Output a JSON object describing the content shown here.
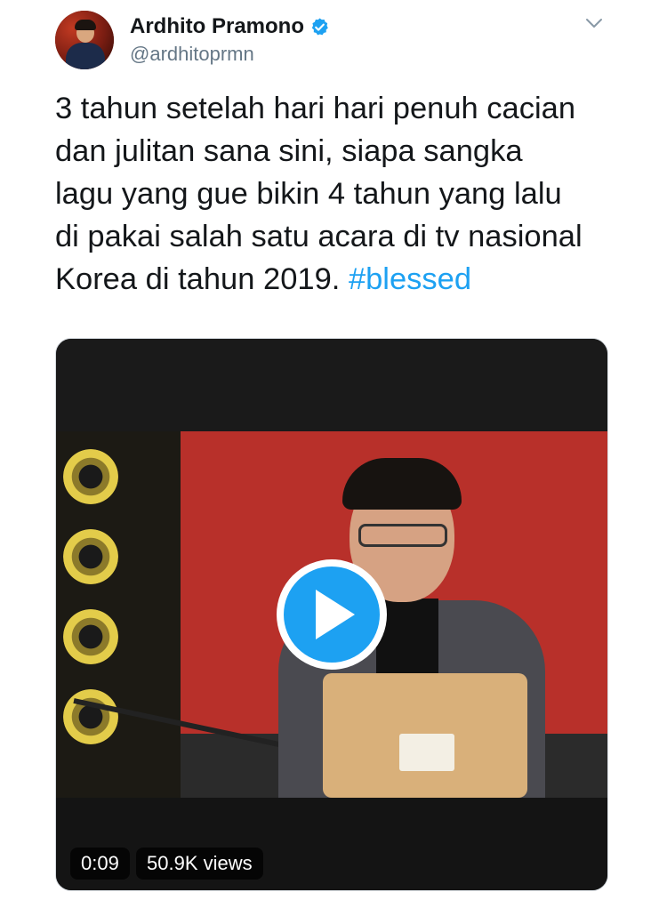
{
  "author": {
    "name": "Ardhito Pramono",
    "handle": "@ardhitoprmn",
    "verified": true,
    "avatar_icon": "avatar"
  },
  "menu_icon": "chevron-down-icon",
  "tweet": {
    "lines": [
      "3 tahun setelah hari hari penuh cacian",
      "dan julitan sana sini, siapa sangka",
      "lagu yang gue bikin 4 tahun yang lalu",
      "di pakai salah satu acara di tv nasional",
      "Korea di tahun 2019."
    ],
    "hashtag": "#blessed",
    "hashtag_color": "#1da1f2"
  },
  "video": {
    "duration": "0:09",
    "views": "50.9K views",
    "play_icon": "play-icon",
    "accent_color": "#1da1f2"
  }
}
